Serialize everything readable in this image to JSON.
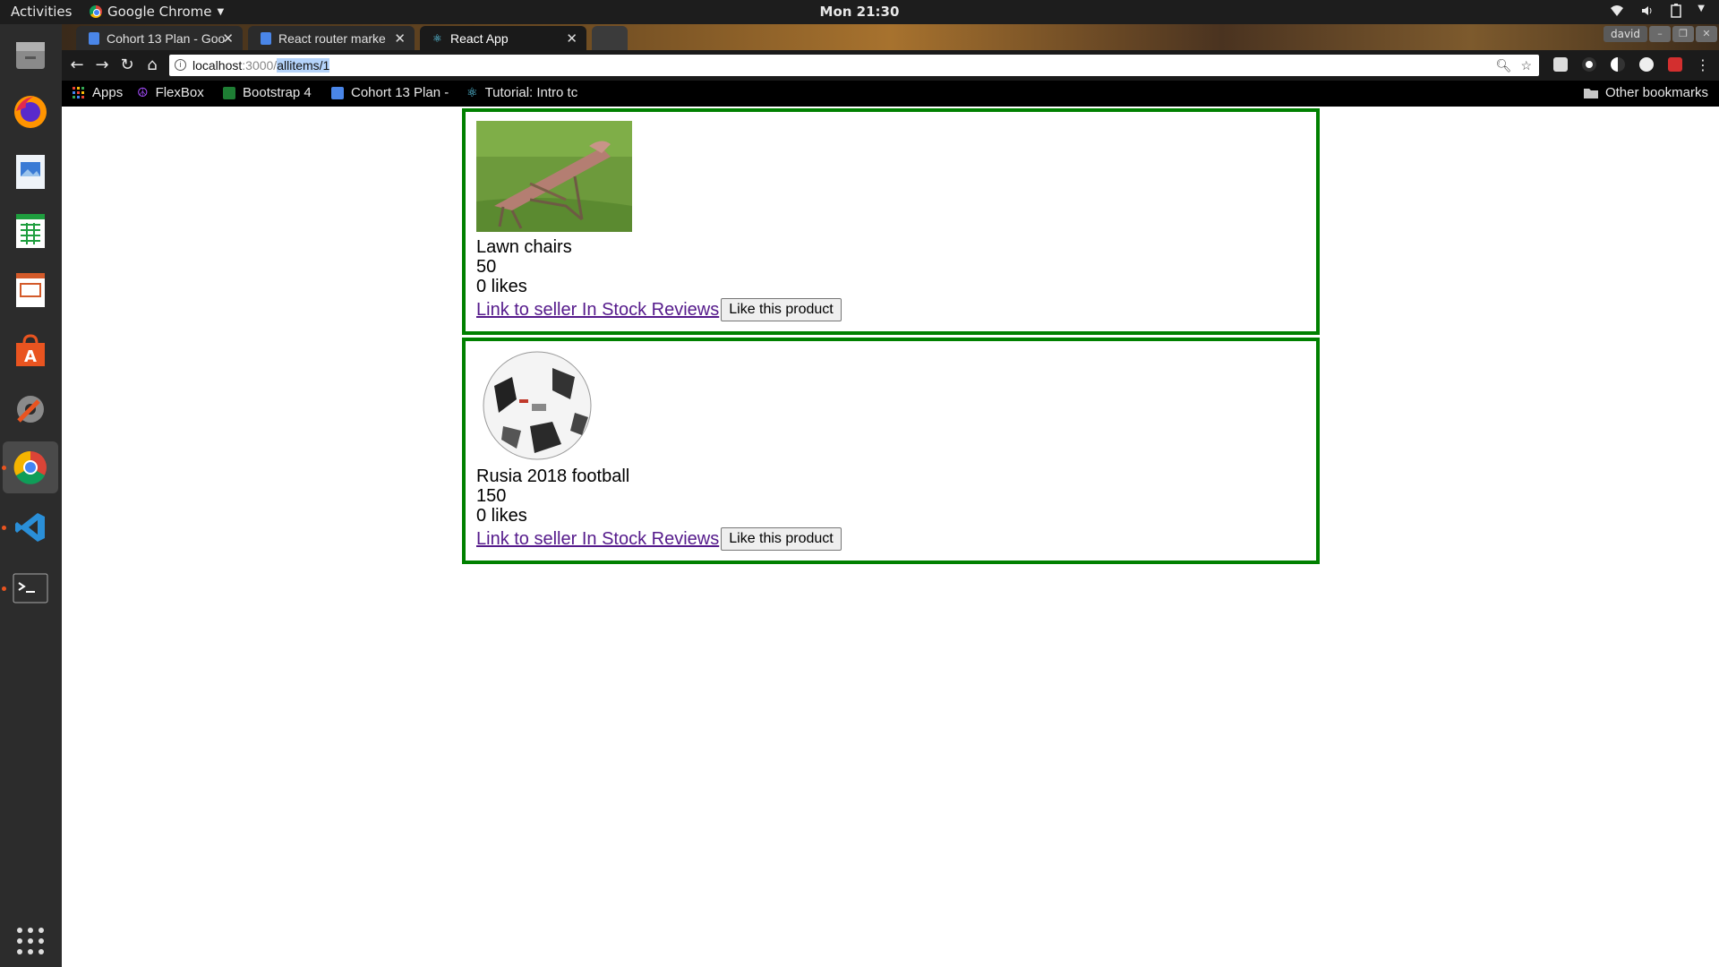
{
  "topbar": {
    "activities": "Activities",
    "app_name": "Google Chrome",
    "clock": "Mon 21:30",
    "tray_icons": [
      "wifi-icon",
      "volume-icon",
      "battery-icon",
      "power-menu-icon"
    ]
  },
  "dock": {
    "items": [
      "files",
      "firefox",
      "image-viewer",
      "spreadsheet",
      "presentation",
      "software-center",
      "settings",
      "chrome",
      "vscode",
      "terminal",
      "show-apps"
    ]
  },
  "browser": {
    "tabs": [
      {
        "title": "Cohort 13 Plan - Goo",
        "icon": "docs-icon"
      },
      {
        "title": "React router marke",
        "icon": "docs-icon"
      },
      {
        "title": "React App",
        "icon": "react-icon"
      }
    ],
    "profile": "david",
    "url": {
      "host": "localhost",
      "port": ":3000/",
      "path": "allitems/1"
    },
    "bookmarks": [
      {
        "label": "Apps",
        "icon": "apps-grid-icon"
      },
      {
        "label": "FlexBox",
        "icon": "peace-icon"
      },
      {
        "label": "Bootstrap 4",
        "icon": "bootstrap-icon"
      },
      {
        "label": "Cohort 13 Plan -",
        "icon": "docs-icon"
      },
      {
        "label": "Tutorial: Intro tc",
        "icon": "react-icon"
      }
    ],
    "other_bookmarks": "Other bookmarks"
  },
  "products": [
    {
      "name": "Lawn chairs",
      "price": "50",
      "likes": "0 likes",
      "link": "Link to seller In Stock Reviews ",
      "like_button": "Like this product",
      "image": "lawn-chair"
    },
    {
      "name": "Rusia 2018 football",
      "price": "150",
      "likes": "0 likes",
      "link": "Link to seller In Stock Reviews ",
      "like_button": "Like this product",
      "image": "football"
    }
  ],
  "colors": {
    "card_border": "#008000",
    "link": "#551a8b"
  }
}
